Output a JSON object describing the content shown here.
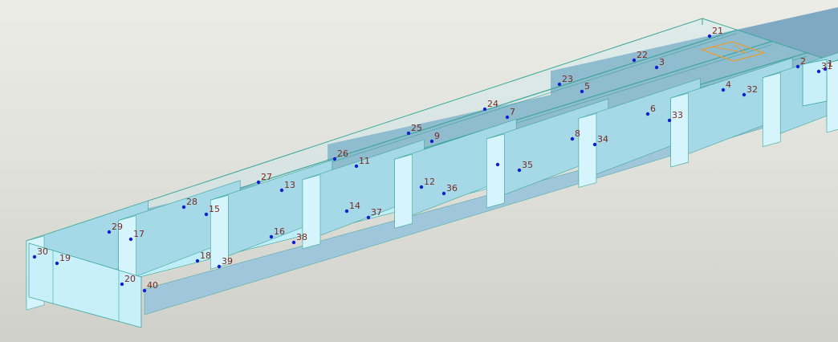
{
  "viewport": {
    "background_top": "#ecece6",
    "background_bottom": "#d0d0ca",
    "wireframe_color": "#3aa79a",
    "node_color": "#1020d0",
    "label_color": "#7a2a20",
    "selection_color": "#e0a040"
  },
  "model": {
    "description_bays": 8,
    "nodes": [
      {
        "id": "1",
        "label": "1"
      },
      {
        "id": "2",
        "label": "2"
      },
      {
        "id": "3",
        "label": "3"
      },
      {
        "id": "4",
        "label": "4"
      },
      {
        "id": "5",
        "label": "5"
      },
      {
        "id": "6",
        "label": "6"
      },
      {
        "id": "7",
        "label": "7"
      },
      {
        "id": "8",
        "label": "8"
      },
      {
        "id": "9",
        "label": "9"
      },
      {
        "id": "11",
        "label": "11"
      },
      {
        "id": "12",
        "label": "12"
      },
      {
        "id": "13",
        "label": "13"
      },
      {
        "id": "14",
        "label": "14"
      },
      {
        "id": "15",
        "label": "15"
      },
      {
        "id": "16",
        "label": "16"
      },
      {
        "id": "17",
        "label": "17"
      },
      {
        "id": "18",
        "label": "18"
      },
      {
        "id": "19",
        "label": "19"
      },
      {
        "id": "20",
        "label": "20"
      },
      {
        "id": "21",
        "label": "21"
      },
      {
        "id": "22",
        "label": "22"
      },
      {
        "id": "23",
        "label": "23"
      },
      {
        "id": "24",
        "label": "24"
      },
      {
        "id": "25",
        "label": "25"
      },
      {
        "id": "26",
        "label": "26"
      },
      {
        "id": "27",
        "label": "27"
      },
      {
        "id": "28",
        "label": "28"
      },
      {
        "id": "29",
        "label": "29"
      },
      {
        "id": "30",
        "label": "30"
      },
      {
        "id": "31",
        "label": "31"
      },
      {
        "id": "32",
        "label": "32"
      },
      {
        "id": "33",
        "label": "33"
      },
      {
        "id": "34",
        "label": "34"
      },
      {
        "id": "35",
        "label": "35"
      },
      {
        "id": "36",
        "label": "36"
      },
      {
        "id": "37",
        "label": "37"
      },
      {
        "id": "38",
        "label": "38"
      },
      {
        "id": "39",
        "label": "39"
      },
      {
        "id": "40",
        "label": "40"
      }
    ]
  }
}
